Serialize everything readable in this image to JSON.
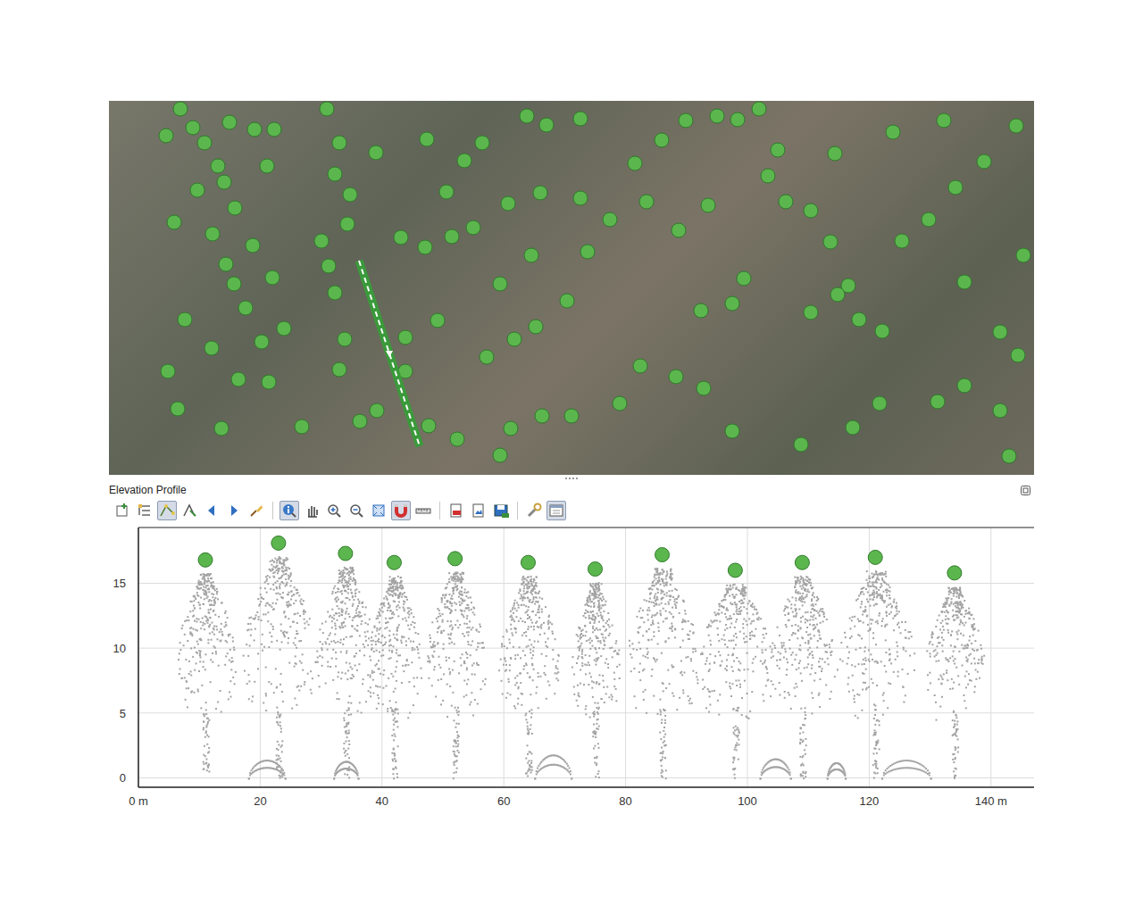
{
  "map": {
    "extent_w": 1036,
    "extent_h": 419,
    "trees": [
      [
        80,
        9
      ],
      [
        94,
        30
      ],
      [
        64,
        39
      ],
      [
        107,
        47
      ],
      [
        122,
        73
      ],
      [
        135,
        24
      ],
      [
        163,
        32
      ],
      [
        185,
        32
      ],
      [
        177,
        73
      ],
      [
        99,
        100
      ],
      [
        129,
        91
      ],
      [
        141,
        120
      ],
      [
        116,
        149
      ],
      [
        73,
        136
      ],
      [
        161,
        162
      ],
      [
        131,
        183
      ],
      [
        183,
        198
      ],
      [
        140,
        205
      ],
      [
        85,
        245
      ],
      [
        153,
        232
      ],
      [
        171,
        270
      ],
      [
        196,
        255
      ],
      [
        115,
        277
      ],
      [
        145,
        312
      ],
      [
        66,
        303
      ],
      [
        179,
        315
      ],
      [
        77,
        345
      ],
      [
        126,
        367
      ],
      [
        216,
        365
      ],
      [
        281,
        359
      ],
      [
        244,
        9
      ],
      [
        258,
        47
      ],
      [
        253,
        82
      ],
      [
        270,
        105
      ],
      [
        267,
        138
      ],
      [
        238,
        157
      ],
      [
        246,
        185
      ],
      [
        253,
        215
      ],
      [
        264,
        267
      ],
      [
        258,
        301
      ],
      [
        299,
        58
      ],
      [
        327,
        153
      ],
      [
        354,
        164
      ],
      [
        384,
        152
      ],
      [
        408,
        142
      ],
      [
        447,
        115
      ],
      [
        483,
        103
      ],
      [
        528,
        109
      ],
      [
        561,
        133
      ],
      [
        589,
        70
      ],
      [
        619,
        44
      ],
      [
        646,
        22
      ],
      [
        681,
        17
      ],
      [
        704,
        21
      ],
      [
        728,
        9
      ],
      [
        749,
        55
      ],
      [
        738,
        84
      ],
      [
        758,
        113
      ],
      [
        786,
        123
      ],
      [
        808,
        158
      ],
      [
        828,
        207
      ],
      [
        786,
        237
      ],
      [
        816,
        217
      ],
      [
        840,
        245
      ],
      [
        866,
        258
      ],
      [
        888,
        157
      ],
      [
        918,
        133
      ],
      [
        948,
        97
      ],
      [
        980,
        68
      ],
      [
        1016,
        28
      ],
      [
        1024,
        173
      ],
      [
        958,
        203
      ],
      [
        998,
        259
      ],
      [
        1018,
        285
      ],
      [
        958,
        319
      ],
      [
        928,
        337
      ],
      [
        863,
        339
      ],
      [
        833,
        366
      ],
      [
        775,
        385
      ],
      [
        698,
        370
      ],
      [
        666,
        322
      ],
      [
        635,
        309
      ],
      [
        595,
        297
      ],
      [
        572,
        339
      ],
      [
        518,
        353
      ],
      [
        485,
        353
      ],
      [
        450,
        367
      ],
      [
        438,
        397
      ],
      [
        390,
        379
      ],
      [
        423,
        287
      ],
      [
        454,
        267
      ],
      [
        478,
        253
      ],
      [
        513,
        224
      ],
      [
        536,
        169
      ],
      [
        438,
        205
      ],
      [
        473,
        173
      ],
      [
        368,
        246
      ],
      [
        332,
        265
      ],
      [
        332,
        303
      ],
      [
        358,
        364
      ],
      [
        300,
        347
      ],
      [
        698,
        227
      ],
      [
        663,
        235
      ],
      [
        711,
        199
      ],
      [
        671,
        117
      ],
      [
        638,
        145
      ],
      [
        602,
        113
      ],
      [
        813,
        59
      ],
      [
        878,
        35
      ],
      [
        935,
        22
      ],
      [
        998,
        347
      ],
      [
        1008,
        398
      ],
      [
        528,
        20
      ],
      [
        490,
        27
      ],
      [
        468,
        17
      ],
      [
        418,
        47
      ],
      [
        398,
        67
      ],
      [
        378,
        102
      ],
      [
        356,
        43
      ]
    ],
    "profile_line": [
      [
        280,
        179
      ],
      [
        348,
        387
      ]
    ]
  },
  "panel": {
    "title": "Elevation Profile"
  },
  "toolbar": [
    {
      "kind": "add-layer",
      "checked": false
    },
    {
      "kind": "layer-tree",
      "checked": false
    },
    {
      "kind": "capture-curve",
      "checked": true
    },
    {
      "kind": "capture-feature",
      "checked": false
    },
    {
      "kind": "back",
      "checked": false
    },
    {
      "kind": "forward",
      "checked": false
    },
    {
      "kind": "clear",
      "checked": false
    },
    {
      "kind": "separator",
      "checked": false
    },
    {
      "kind": "identify",
      "checked": true
    },
    {
      "kind": "pan",
      "checked": false
    },
    {
      "kind": "zoom-in",
      "checked": false
    },
    {
      "kind": "zoom-out",
      "checked": false
    },
    {
      "kind": "zoom-full",
      "checked": false
    },
    {
      "kind": "snapping",
      "checked": true
    },
    {
      "kind": "measure",
      "checked": false
    },
    {
      "kind": "separator",
      "checked": false
    },
    {
      "kind": "export-pdf",
      "checked": false
    },
    {
      "kind": "export-image",
      "checked": false
    },
    {
      "kind": "export-3d",
      "checked": false
    },
    {
      "kind": "separator",
      "checked": false
    },
    {
      "kind": "options",
      "checked": false
    },
    {
      "kind": "dock",
      "checked": true
    }
  ],
  "chart": {
    "y_ticks": [
      "0",
      "5",
      "10",
      "15"
    ],
    "x_ticks": [
      "0 m",
      "20",
      "40",
      "60",
      "80",
      "100",
      "120",
      "140 m"
    ],
    "tree_tops": {
      "distance": [
        11,
        23,
        34,
        42,
        52,
        64,
        75,
        86,
        98,
        109,
        121,
        134
      ],
      "elevation": [
        16.8,
        18.1,
        17.3,
        16.6,
        16.9,
        16.6,
        16.1,
        17.2,
        16.0,
        16.6,
        17.0,
        15.8
      ]
    },
    "crown_widths": [
      10,
      12,
      10,
      9,
      10,
      10,
      8,
      12,
      13,
      11,
      13,
      10
    ],
    "ground_humps": [
      [
        18,
        24,
        1.4
      ],
      [
        32,
        36,
        1.3
      ],
      [
        65,
        71,
        1.8
      ],
      [
        102,
        107,
        1.5
      ],
      [
        113,
        116,
        1.2
      ],
      [
        122,
        130,
        1.4
      ]
    ]
  }
}
